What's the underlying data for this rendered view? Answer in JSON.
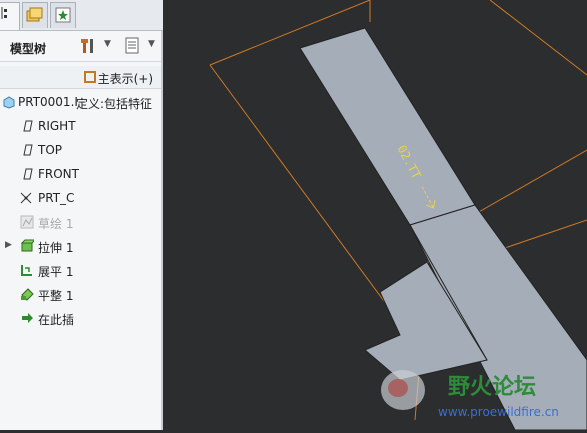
{
  "tree": {
    "title": "模型树",
    "column_header": "主表示(+)",
    "root_label": "PRT0001.I",
    "root_def": "定义:包括特征",
    "items": [
      {
        "label": "RIGHT",
        "icon": "datum-plane-icon"
      },
      {
        "label": "TOP",
        "icon": "datum-plane-icon"
      },
      {
        "label": "FRONT",
        "icon": "datum-plane-icon"
      },
      {
        "label": "PRT_C",
        "icon": "coordinate-system-icon"
      },
      {
        "label": "草绘 1",
        "icon": "sketch-icon"
      },
      {
        "label": "拉伸 1",
        "icon": "extrude-icon"
      },
      {
        "label": "展平 1",
        "icon": "unbend-icon"
      },
      {
        "label": "平整 1",
        "icon": "flat-wall-icon"
      },
      {
        "label": "在此插",
        "icon": "insert-arrow-icon"
      }
    ]
  },
  "viewport": {
    "dimension_text": "02.TT",
    "background": "#2b2d2f",
    "surface_color": "#a4adb8",
    "edge_color": "#e08a2a"
  },
  "watermark": {
    "text": "野火论坛",
    "url": "www.proewildfire.cn"
  },
  "colors": {
    "panel_bg": "#f4f6f8",
    "accent_green": "#2e8b2e",
    "dim_yellow": "#e8d24a"
  }
}
